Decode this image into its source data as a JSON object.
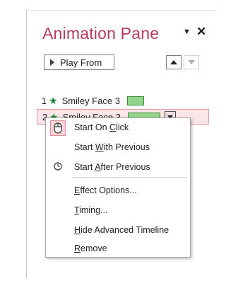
{
  "pane": {
    "title": "Animation Pane",
    "menu_glyph": "▼",
    "close_glyph": "✕",
    "play_from_label": "Play From"
  },
  "animations": [
    {
      "number": "1",
      "name": "Smiley Face 3",
      "icon": "star-icon",
      "bar_color": "#92d58a",
      "selected": false
    },
    {
      "number": "2",
      "name": "Smiley Face 3",
      "icon": "star-icon",
      "bar_color": "#92d58a",
      "selected": true
    }
  ],
  "context_menu": {
    "items": [
      {
        "before": "Start On ",
        "mnemonic": "C",
        "after": "lick",
        "icon": "mouse-icon",
        "checked": true
      },
      {
        "before": "Start ",
        "mnemonic": "W",
        "after": "ith Previous",
        "icon": null,
        "checked": false
      },
      {
        "before": "Start ",
        "mnemonic": "A",
        "after": "fter Previous",
        "icon": "clock-icon",
        "checked": false
      },
      {
        "before": "",
        "mnemonic": "E",
        "after": "ffect Options...",
        "icon": null
      },
      {
        "before": "",
        "mnemonic": "T",
        "after": "iming...",
        "icon": null
      },
      {
        "before": "",
        "mnemonic": "H",
        "after": "ide Advanced Timeline",
        "icon": null
      },
      {
        "before": "",
        "mnemonic": "R",
        "after": "emove",
        "icon": null
      }
    ]
  },
  "colors": {
    "title": "#b83b5e",
    "selection_bg": "#fbe5e8",
    "selection_border": "#e59aa6",
    "star": "#1e7d32"
  }
}
